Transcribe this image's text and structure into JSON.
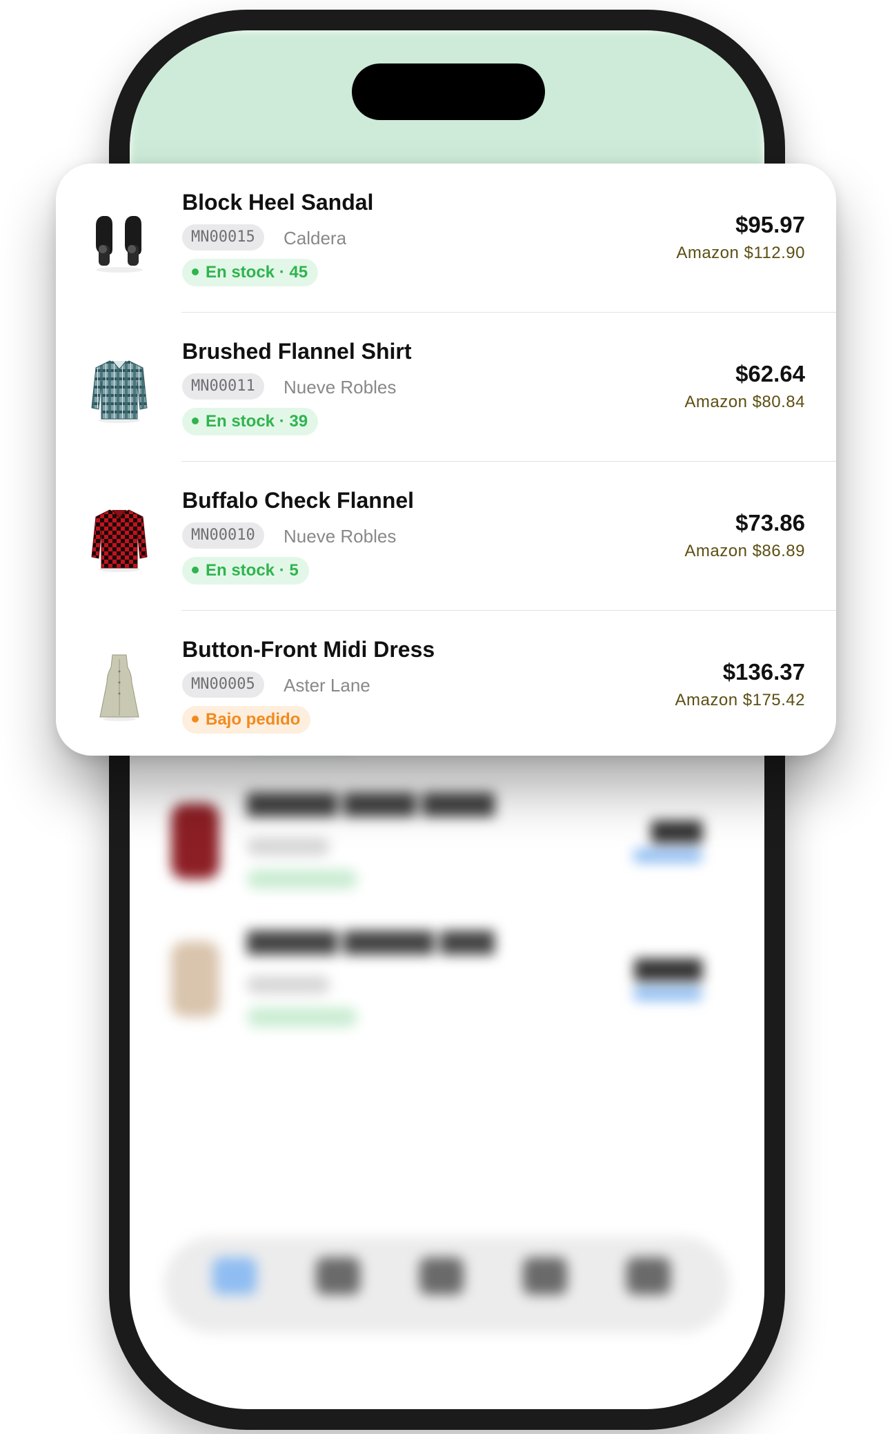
{
  "products": [
    {
      "name": "Block Heel Sandal",
      "sku": "MN00015",
      "brand": "Caldera",
      "stock": "En stock · 45",
      "stock_status": "in-stock",
      "price": "$95.97",
      "amazon": "Amazon $112.90",
      "thumb_icon": "sandal-icon"
    },
    {
      "name": "Brushed Flannel Shirt",
      "sku": "MN00011",
      "brand": "Nueve Robles",
      "stock": "En stock · 39",
      "stock_status": "in-stock",
      "price": "$62.64",
      "amazon": "Amazon $80.84",
      "thumb_icon": "shirt-icon"
    },
    {
      "name": "Buffalo Check Flannel",
      "sku": "MN00010",
      "brand": "Nueve Robles",
      "stock": "En stock · 5",
      "stock_status": "in-stock",
      "price": "$73.86",
      "amazon": "Amazon $86.89",
      "thumb_icon": "shirt-icon"
    },
    {
      "name": "Button-Front Midi Dress",
      "sku": "MN00005",
      "brand": "Aster Lane",
      "stock": "Bajo pedido",
      "stock_status": "backorder",
      "price": "$136.37",
      "amazon": "Amazon $175.42",
      "thumb_icon": "dress-icon"
    }
  ],
  "colors": {
    "in_stock": "#2fb44f",
    "backorder": "#f28a1d",
    "amazon_price": "#5c4e12",
    "header_tint": "#cdebd8"
  }
}
